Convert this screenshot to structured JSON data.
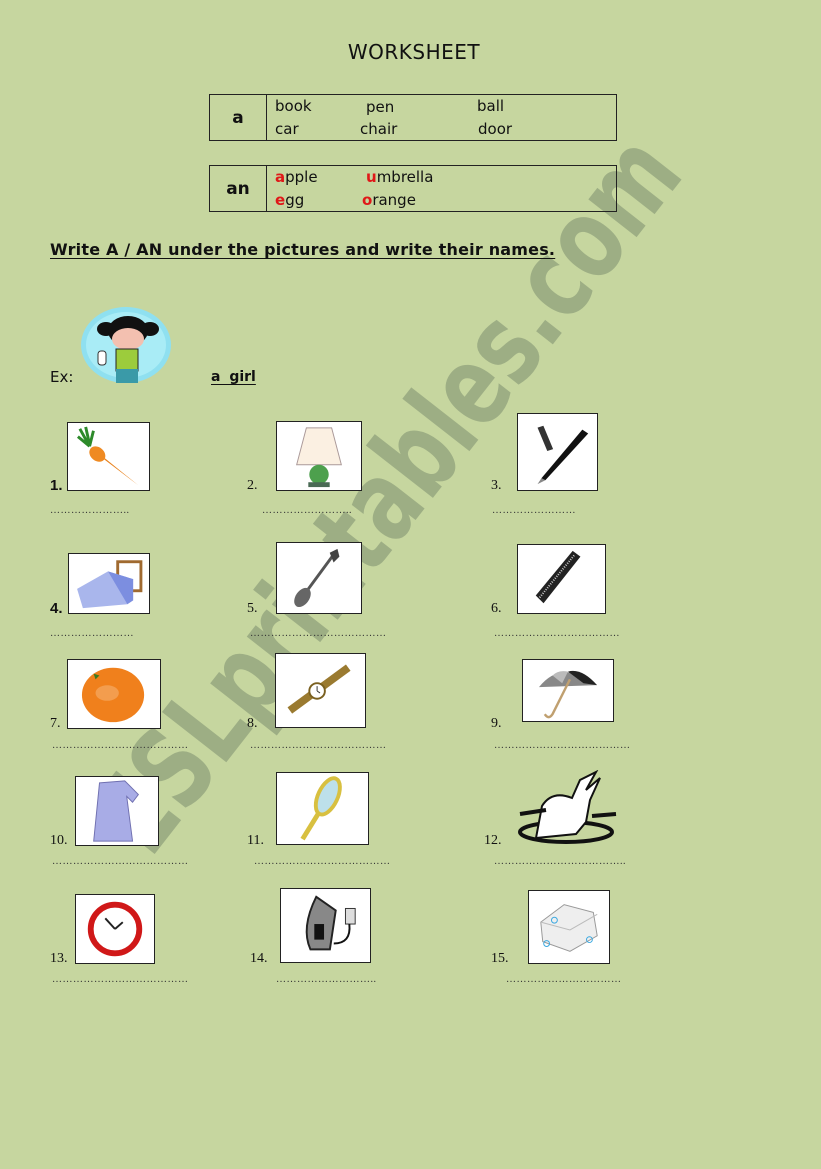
{
  "title": "WORKSHEET",
  "rules": [
    {
      "article": "a",
      "words": [
        [
          "book",
          "pen",
          "ball"
        ],
        [
          "car",
          "chair",
          "door"
        ]
      ]
    },
    {
      "article": "an",
      "words": [
        [
          {
            "first": "a",
            "rest": "pple"
          },
          {
            "first": "u",
            "rest": "mbrella"
          }
        ],
        [
          {
            "first": "e",
            "rest": "gg"
          },
          {
            "first": "o",
            "rest": "range"
          }
        ]
      ]
    }
  ],
  "instruction": "Write A / AN under the pictures and write their names.",
  "example": {
    "label": "Ex:",
    "answer": "a girl",
    "picture": "girl-icon"
  },
  "exercises": [
    {
      "number": "1.",
      "picture": "carrot-icon",
      "blank": "………………….."
    },
    {
      "number": "2.",
      "picture": "lamp-icon",
      "blank": "…………………….."
    },
    {
      "number": "3.",
      "picture": "pen-icon",
      "blank": "……………………"
    },
    {
      "number": "4.",
      "picture": "bed-icon",
      "blank": "……………………"
    },
    {
      "number": "5.",
      "picture": "spoon-icon",
      "blank": "…………………………………"
    },
    {
      "number": "6.",
      "picture": "comb-icon",
      "blank": "………………………………"
    },
    {
      "number": "7.",
      "picture": "orange-icon",
      "blank": "…………………………………"
    },
    {
      "number": "8.",
      "picture": "watch-icon",
      "blank": "…………………………………"
    },
    {
      "number": "9.",
      "picture": "umbrella-icon",
      "blank": "…………………………………"
    },
    {
      "number": "10.",
      "picture": "dress-icon",
      "blank": "…………………………………"
    },
    {
      "number": "11.",
      "picture": "mirror-icon",
      "blank": "…………………………………"
    },
    {
      "number": "12.",
      "picture": "elephant-icon",
      "blank": "……………………………….."
    },
    {
      "number": "13.",
      "picture": "clock-icon",
      "blank": "…………………………………"
    },
    {
      "number": "14.",
      "picture": "iron-icon",
      "blank": "……………………….."
    },
    {
      "number": "15.",
      "picture": "soap-icon",
      "blank": "……………………………"
    }
  ],
  "watermark": "ESLprintables.com",
  "colors": {
    "background": "#c6d69f",
    "accent_red": "#e01818",
    "watermark": "#97a880"
  }
}
